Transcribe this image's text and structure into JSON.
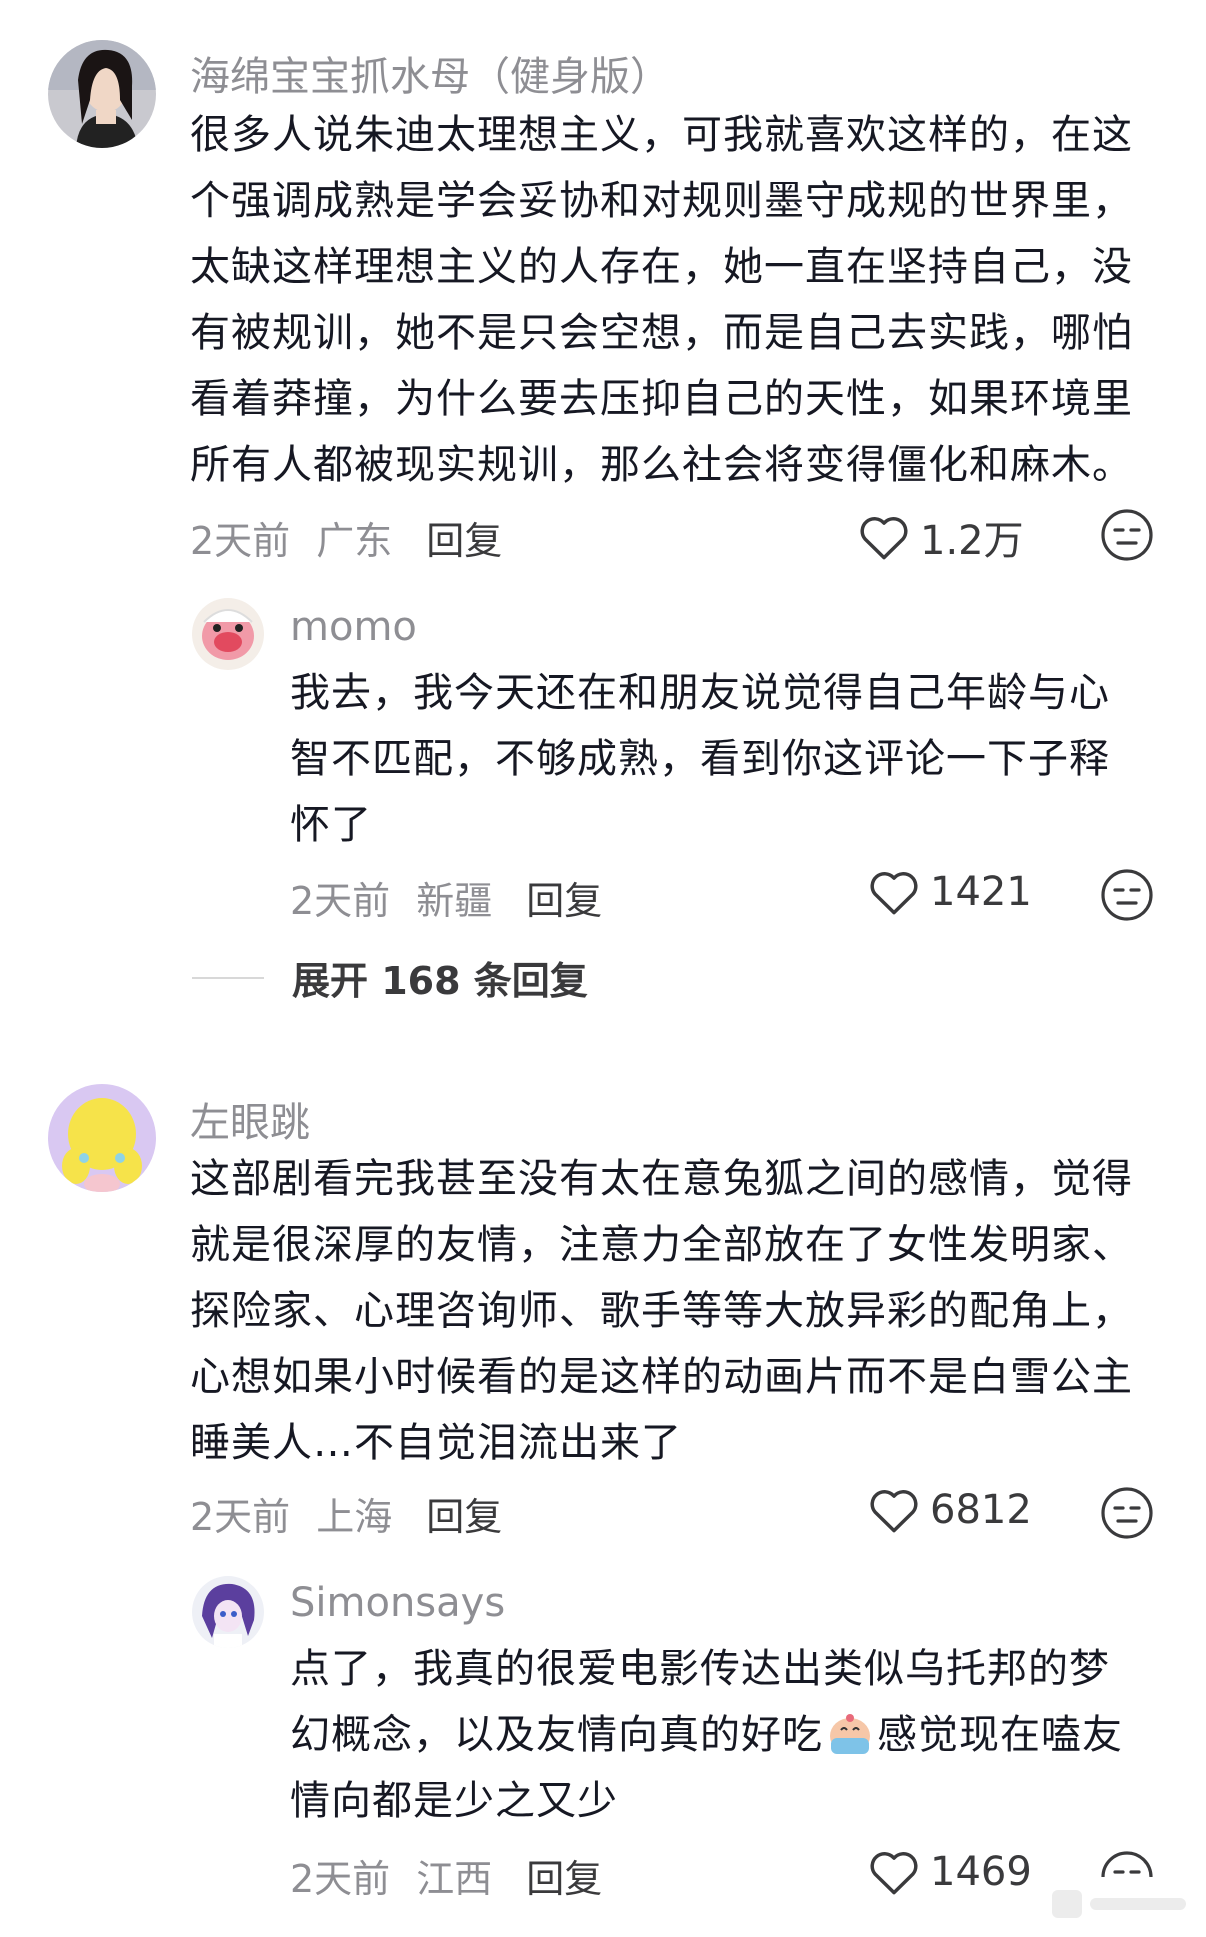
{
  "comments": [
    {
      "username": "海绵宝宝抓水母（健身版）",
      "lines": [
        "很多人说朱迪太理想主义，可我就喜欢这样的，在这",
        "个强调成熟是学会妥协和对规则墨守成规的世界里，",
        "太缺这样理想主义的人存在，她一直在坚持自己，没",
        "有被规训，她不是只会空想，而是自己去实践，哪怕",
        "看着莽撞，为什么要去压抑自己的天性，如果环境里",
        "所有人都被现实规训，那么社会将变得僵化和麻木。"
      ],
      "time": "2天前",
      "location": "广东",
      "reply_label": "回复",
      "likes": "1.2万"
    },
    {
      "username": "momo",
      "lines": [
        "我去，我今天还在和朋友说觉得自己年龄与心",
        "智不匹配，不够成熟，看到你这评论一下子释",
        "怀了"
      ],
      "time": "2天前",
      "location": "新疆",
      "reply_label": "回复",
      "likes": "1421"
    },
    {
      "username": "左眼跳",
      "lines": [
        "这部剧看完我甚至没有太在意兔狐之间的感情，觉得",
        "就是很深厚的友情，注意力全部放在了女性发明家、",
        "探险家、心理咨询师、歌手等等大放异彩的配角上，",
        "心想如果小时候看的是这样的动画片而不是白雪公主",
        "睡美人…不自觉泪流出来了"
      ],
      "time": "2天前",
      "location": "上海",
      "reply_label": "回复",
      "likes": "6812"
    },
    {
      "username": "Simonsays",
      "lines": [
        "点了，我真的很爱电影传达出类似乌托邦的梦",
        "幻概念，以及友情向真的好吃",
        "感觉现在嗑友",
        "情向都是少之又少"
      ],
      "time": "2天前",
      "location": "江西",
      "reply_label": "回复",
      "likes": "1469"
    }
  ],
  "expand_replies": "展开 168 条回复",
  "icons": {
    "like": "heart-outline-icon",
    "dislike": "unamused-face-icon",
    "inline_emoji": "crying-eating-emoji"
  },
  "colors": {
    "username": "#8e8e93",
    "text": "#161823",
    "meta": "#8e8e93"
  }
}
